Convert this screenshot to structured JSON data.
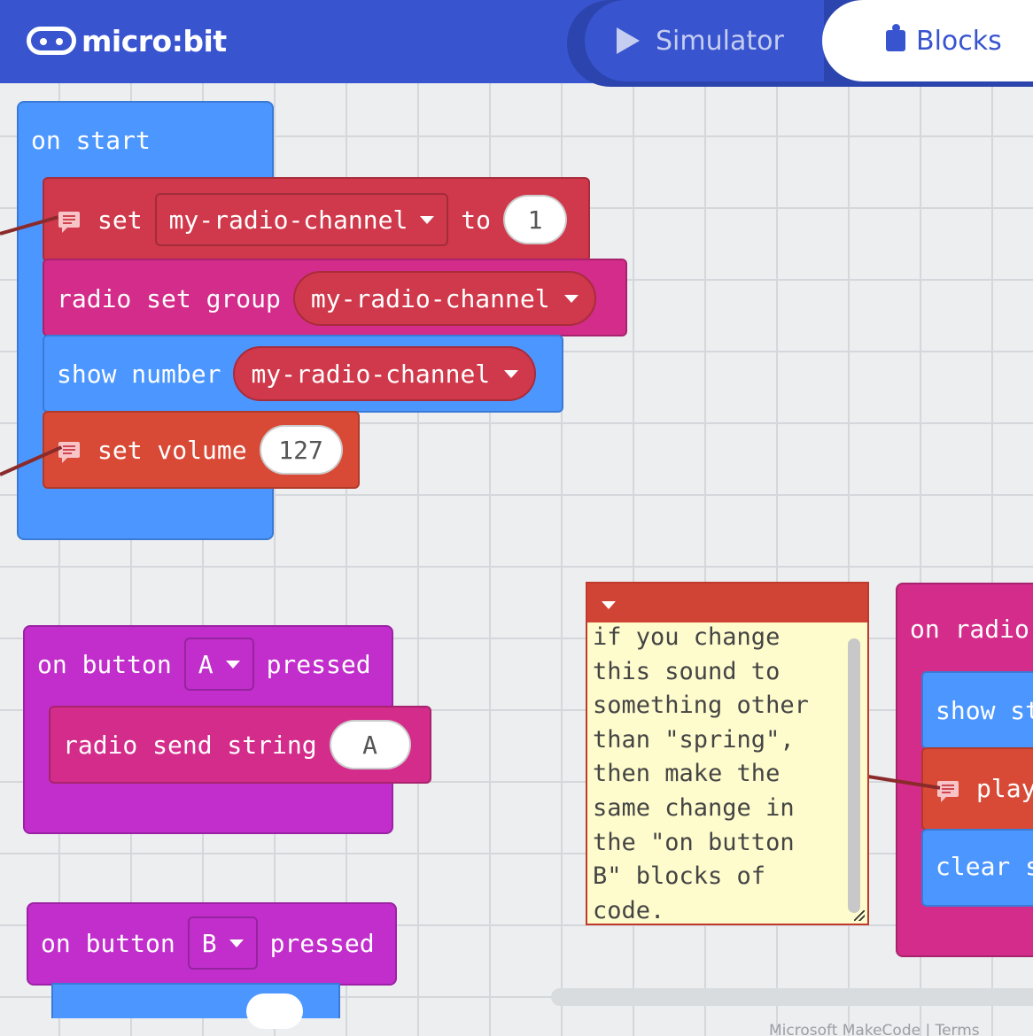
{
  "header": {
    "logo_text": "micro:bit",
    "tabs": [
      {
        "label": "Simulator",
        "icon": "play-icon",
        "active": false
      },
      {
        "label": "Blocks",
        "icon": "puzzle-icon",
        "active": true
      }
    ]
  },
  "colors": {
    "header": "#3854cf",
    "basic": "#4c97ff",
    "variables": "#d0394b",
    "radio": "#d42c8a",
    "music": "#d84a36",
    "input": "#c12ecc",
    "comment_bg": "#fefccd"
  },
  "blocks": {
    "on_start": {
      "label": "on start",
      "set": {
        "kw": "set",
        "variable": "my-radio-channel",
        "to": "to",
        "value": "1"
      },
      "radio_set_group": {
        "label": "radio set group",
        "variable": "my-radio-channel"
      },
      "show_number": {
        "label": "show number",
        "variable": "my-radio-channel"
      },
      "set_volume": {
        "label": "set volume",
        "value": "127"
      }
    },
    "on_button_a": {
      "on": "on button",
      "button": "A",
      "pressed": "pressed",
      "send": {
        "label": "radio send string",
        "value": "A"
      }
    },
    "on_button_b": {
      "on": "on button",
      "button": "B",
      "pressed": "pressed"
    },
    "on_radio": {
      "label": "on radio",
      "show": "show st",
      "play": "play",
      "clear": "clear s"
    }
  },
  "comment": {
    "text": "if you change\nthis sound to\nsomething other\nthan \"spring\",\nthen make the\nsame change in\nthe \"on button\nB\" blocks of\ncode."
  },
  "footer": {
    "text": "Microsoft MakeCode | Terms"
  }
}
